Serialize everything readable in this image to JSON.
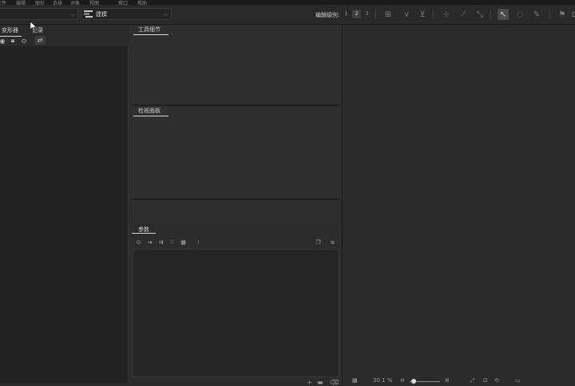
{
  "menubar": {
    "items": [
      "文件",
      "编辑",
      "图形",
      "选择",
      "对象",
      "视图",
      "高级",
      "窗口",
      "帮助"
    ]
  },
  "toolbar": {
    "mode_combo": {
      "label": "建模"
    },
    "edit_level_label": "编辑级别:",
    "levels": [
      "1",
      "2",
      "3"
    ],
    "selected_level": "2"
  },
  "left_panel": {
    "tabs": [
      "变形器",
      "记录"
    ]
  },
  "middle": {
    "tool_detail_title": "工具细节",
    "inspector_title": "检视面板",
    "params_title": "参数"
  },
  "viewport": {
    "zoom_text": "30.1 %"
  },
  "colors": {
    "background": "#2b2b2b",
    "panel_dark": "#222222",
    "accent_underline": "#d7d7d7"
  }
}
